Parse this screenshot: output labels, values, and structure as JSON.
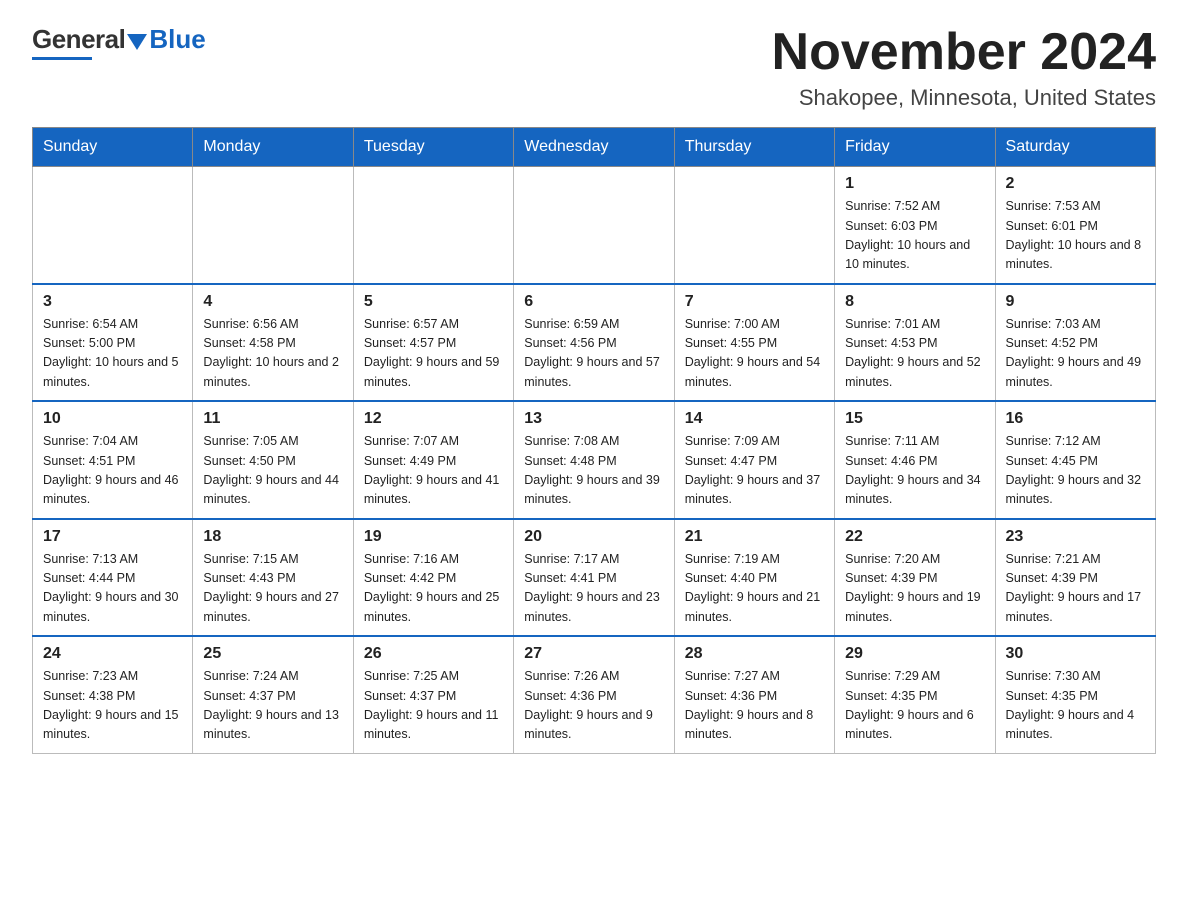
{
  "logo": {
    "general": "General",
    "blue": "Blue"
  },
  "title": {
    "month_year": "November 2024",
    "location": "Shakopee, Minnesota, United States"
  },
  "weekdays": [
    "Sunday",
    "Monday",
    "Tuesday",
    "Wednesday",
    "Thursday",
    "Friday",
    "Saturday"
  ],
  "weeks": [
    [
      {
        "day": "",
        "sunrise": "",
        "sunset": "",
        "daylight": ""
      },
      {
        "day": "",
        "sunrise": "",
        "sunset": "",
        "daylight": ""
      },
      {
        "day": "",
        "sunrise": "",
        "sunset": "",
        "daylight": ""
      },
      {
        "day": "",
        "sunrise": "",
        "sunset": "",
        "daylight": ""
      },
      {
        "day": "",
        "sunrise": "",
        "sunset": "",
        "daylight": ""
      },
      {
        "day": "1",
        "sunrise": "Sunrise: 7:52 AM",
        "sunset": "Sunset: 6:03 PM",
        "daylight": "Daylight: 10 hours and 10 minutes."
      },
      {
        "day": "2",
        "sunrise": "Sunrise: 7:53 AM",
        "sunset": "Sunset: 6:01 PM",
        "daylight": "Daylight: 10 hours and 8 minutes."
      }
    ],
    [
      {
        "day": "3",
        "sunrise": "Sunrise: 6:54 AM",
        "sunset": "Sunset: 5:00 PM",
        "daylight": "Daylight: 10 hours and 5 minutes."
      },
      {
        "day": "4",
        "sunrise": "Sunrise: 6:56 AM",
        "sunset": "Sunset: 4:58 PM",
        "daylight": "Daylight: 10 hours and 2 minutes."
      },
      {
        "day": "5",
        "sunrise": "Sunrise: 6:57 AM",
        "sunset": "Sunset: 4:57 PM",
        "daylight": "Daylight: 9 hours and 59 minutes."
      },
      {
        "day": "6",
        "sunrise": "Sunrise: 6:59 AM",
        "sunset": "Sunset: 4:56 PM",
        "daylight": "Daylight: 9 hours and 57 minutes."
      },
      {
        "day": "7",
        "sunrise": "Sunrise: 7:00 AM",
        "sunset": "Sunset: 4:55 PM",
        "daylight": "Daylight: 9 hours and 54 minutes."
      },
      {
        "day": "8",
        "sunrise": "Sunrise: 7:01 AM",
        "sunset": "Sunset: 4:53 PM",
        "daylight": "Daylight: 9 hours and 52 minutes."
      },
      {
        "day": "9",
        "sunrise": "Sunrise: 7:03 AM",
        "sunset": "Sunset: 4:52 PM",
        "daylight": "Daylight: 9 hours and 49 minutes."
      }
    ],
    [
      {
        "day": "10",
        "sunrise": "Sunrise: 7:04 AM",
        "sunset": "Sunset: 4:51 PM",
        "daylight": "Daylight: 9 hours and 46 minutes."
      },
      {
        "day": "11",
        "sunrise": "Sunrise: 7:05 AM",
        "sunset": "Sunset: 4:50 PM",
        "daylight": "Daylight: 9 hours and 44 minutes."
      },
      {
        "day": "12",
        "sunrise": "Sunrise: 7:07 AM",
        "sunset": "Sunset: 4:49 PM",
        "daylight": "Daylight: 9 hours and 41 minutes."
      },
      {
        "day": "13",
        "sunrise": "Sunrise: 7:08 AM",
        "sunset": "Sunset: 4:48 PM",
        "daylight": "Daylight: 9 hours and 39 minutes."
      },
      {
        "day": "14",
        "sunrise": "Sunrise: 7:09 AM",
        "sunset": "Sunset: 4:47 PM",
        "daylight": "Daylight: 9 hours and 37 minutes."
      },
      {
        "day": "15",
        "sunrise": "Sunrise: 7:11 AM",
        "sunset": "Sunset: 4:46 PM",
        "daylight": "Daylight: 9 hours and 34 minutes."
      },
      {
        "day": "16",
        "sunrise": "Sunrise: 7:12 AM",
        "sunset": "Sunset: 4:45 PM",
        "daylight": "Daylight: 9 hours and 32 minutes."
      }
    ],
    [
      {
        "day": "17",
        "sunrise": "Sunrise: 7:13 AM",
        "sunset": "Sunset: 4:44 PM",
        "daylight": "Daylight: 9 hours and 30 minutes."
      },
      {
        "day": "18",
        "sunrise": "Sunrise: 7:15 AM",
        "sunset": "Sunset: 4:43 PM",
        "daylight": "Daylight: 9 hours and 27 minutes."
      },
      {
        "day": "19",
        "sunrise": "Sunrise: 7:16 AM",
        "sunset": "Sunset: 4:42 PM",
        "daylight": "Daylight: 9 hours and 25 minutes."
      },
      {
        "day": "20",
        "sunrise": "Sunrise: 7:17 AM",
        "sunset": "Sunset: 4:41 PM",
        "daylight": "Daylight: 9 hours and 23 minutes."
      },
      {
        "day": "21",
        "sunrise": "Sunrise: 7:19 AM",
        "sunset": "Sunset: 4:40 PM",
        "daylight": "Daylight: 9 hours and 21 minutes."
      },
      {
        "day": "22",
        "sunrise": "Sunrise: 7:20 AM",
        "sunset": "Sunset: 4:39 PM",
        "daylight": "Daylight: 9 hours and 19 minutes."
      },
      {
        "day": "23",
        "sunrise": "Sunrise: 7:21 AM",
        "sunset": "Sunset: 4:39 PM",
        "daylight": "Daylight: 9 hours and 17 minutes."
      }
    ],
    [
      {
        "day": "24",
        "sunrise": "Sunrise: 7:23 AM",
        "sunset": "Sunset: 4:38 PM",
        "daylight": "Daylight: 9 hours and 15 minutes."
      },
      {
        "day": "25",
        "sunrise": "Sunrise: 7:24 AM",
        "sunset": "Sunset: 4:37 PM",
        "daylight": "Daylight: 9 hours and 13 minutes."
      },
      {
        "day": "26",
        "sunrise": "Sunrise: 7:25 AM",
        "sunset": "Sunset: 4:37 PM",
        "daylight": "Daylight: 9 hours and 11 minutes."
      },
      {
        "day": "27",
        "sunrise": "Sunrise: 7:26 AM",
        "sunset": "Sunset: 4:36 PM",
        "daylight": "Daylight: 9 hours and 9 minutes."
      },
      {
        "day": "28",
        "sunrise": "Sunrise: 7:27 AM",
        "sunset": "Sunset: 4:36 PM",
        "daylight": "Daylight: 9 hours and 8 minutes."
      },
      {
        "day": "29",
        "sunrise": "Sunrise: 7:29 AM",
        "sunset": "Sunset: 4:35 PM",
        "daylight": "Daylight: 9 hours and 6 minutes."
      },
      {
        "day": "30",
        "sunrise": "Sunrise: 7:30 AM",
        "sunset": "Sunset: 4:35 PM",
        "daylight": "Daylight: 9 hours and 4 minutes."
      }
    ]
  ]
}
